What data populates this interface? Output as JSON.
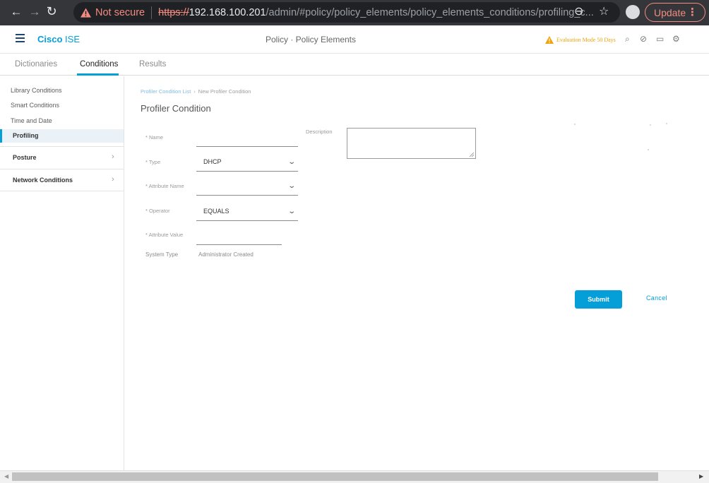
{
  "browser": {
    "security_label": "Not secure",
    "url_scheme": "https://",
    "url_host": "192.168.100.201",
    "url_path": "/admin/#policy/policy_elements/policy_elements_conditions/profiling_c...",
    "update_label": "Update",
    "colors": {
      "warning": "#f28b82",
      "chrome_bg": "#35363a"
    }
  },
  "header": {
    "brand_cisco": "Cisco",
    "brand_product": "ISE",
    "title": "Policy · Policy Elements",
    "evaluation_notice": "Evaluation Mode 50 Days",
    "icons": [
      "search-icon",
      "help-icon",
      "notifications-icon",
      "settings-icon"
    ]
  },
  "tabs": [
    {
      "label": "Dictionaries",
      "active": false
    },
    {
      "label": "Conditions",
      "active": true
    },
    {
      "label": "Results",
      "active": false
    }
  ],
  "sidebar": {
    "items": [
      {
        "label": "Library Conditions"
      },
      {
        "label": "Smart Conditions"
      },
      {
        "label": "Time and Date"
      },
      {
        "label": "Profiling",
        "active": true
      }
    ],
    "groups": [
      {
        "label": "Posture"
      },
      {
        "label": "Network Conditions"
      }
    ]
  },
  "breadcrumb": {
    "parent": "Profiler Condition List",
    "current": "New Profiler Condition"
  },
  "page_title": "Profiler Condition",
  "form": {
    "name_label": "* Name",
    "name_value": "",
    "description_label": "Description",
    "description_value": "",
    "type_label": "* Type",
    "type_value": "DHCP",
    "attribute_name_label": "* Attribute Name",
    "attribute_name_value": "",
    "operator_label": "* Operator",
    "operator_value": "EQUALS",
    "attribute_value_label": "* Attribute Value",
    "attribute_value_value": "",
    "system_type_label": "System Type",
    "system_type_value": "Administrator Created"
  },
  "actions": {
    "submit_label": "Submit",
    "cancel_label": "Cancel"
  },
  "theme": {
    "accent": "#049fd9",
    "evaluation_color": "#f0a30a"
  }
}
